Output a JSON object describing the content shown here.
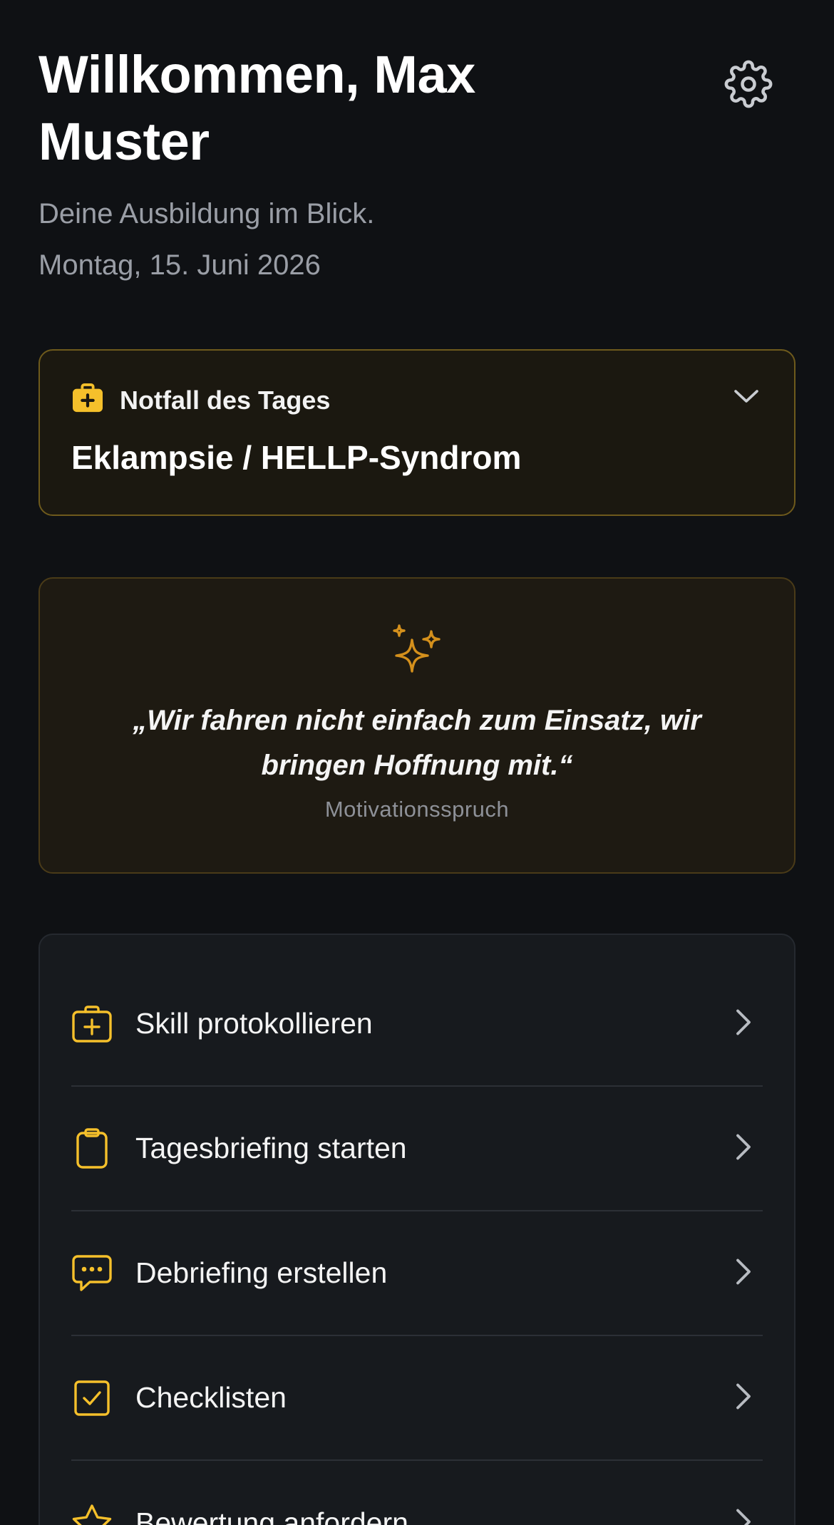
{
  "header": {
    "title": "Willkommen, Max Muster",
    "subtitle": "Deine Ausbildung im Blick.",
    "date": "Montag, 15. Juni 2026",
    "settings_icon": "gear-icon"
  },
  "emergency_card": {
    "label": "Notfall des Tages",
    "title": "Eklampsie / HELLP-Syndrom",
    "icon": "medical-kit-icon",
    "toggle_icon": "chevron-down-icon"
  },
  "quote_card": {
    "icon": "sparkles-icon",
    "text": "„Wir fahren nicht einfach zum Einsatz, wir bringen Hoffnung mit.“",
    "caption": "Motivationsspruch"
  },
  "actions": [
    {
      "label": "Skill protokollieren",
      "icon": "medical-bag-plus-icon"
    },
    {
      "label": "Tagesbriefing starten",
      "icon": "clipboard-icon"
    },
    {
      "label": "Debriefing erstellen",
      "icon": "chat-bubble-icon"
    },
    {
      "label": "Checklisten",
      "icon": "checkbox-icon"
    },
    {
      "label": "Bewertung anfordern",
      "icon": "star-icon"
    }
  ],
  "colors": {
    "background": "#0f1114",
    "accent": "#f5c02b",
    "accent_dark": "#d4901c",
    "card_border_gold": "#6e5a1c",
    "muted_text": "#9a9ea6"
  }
}
